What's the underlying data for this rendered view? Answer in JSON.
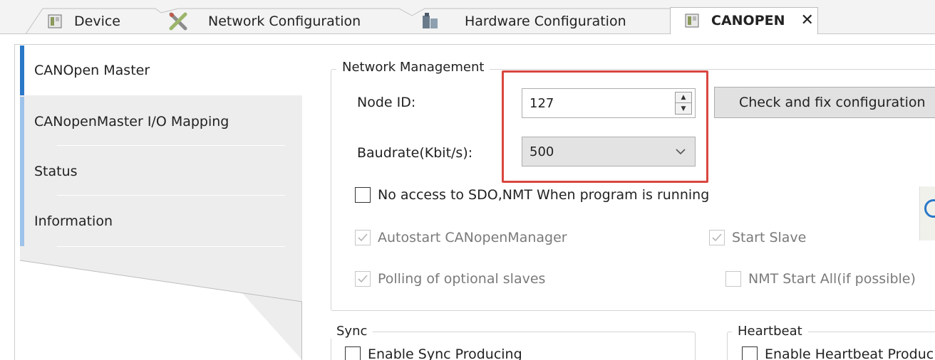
{
  "tabs": [
    {
      "label": "Device",
      "icon": "device-icon"
    },
    {
      "label": "Network Configuration",
      "icon": "tools-icon"
    },
    {
      "label": "Hardware Configuration",
      "icon": "hardware-icon"
    },
    {
      "label": "CANOPEN",
      "icon": "device-icon",
      "close": "✕"
    }
  ],
  "sidebar": {
    "items": [
      {
        "label": "CANOpen Master"
      },
      {
        "label": "CANopenMaster I/O Mapping"
      },
      {
        "label": "Status"
      },
      {
        "label": "Information"
      }
    ]
  },
  "network_management": {
    "title": "Network Management",
    "node_id_label": "Node ID:",
    "node_id_value": "127",
    "baudrate_label": "Baudrate(Kbit/s):",
    "baudrate_value": "500",
    "check_button": "Check and fix configuration",
    "no_access_label": "No access to SDO,NMT When program is running",
    "autostart_label": "Autostart CANopenManager",
    "start_slave_label": "Start Slave",
    "polling_label": "Polling of optional slaves",
    "nmt_start_all_label": "NMT Start All(if possible)"
  },
  "sync": {
    "title": "Sync",
    "enable_label": "Enable Sync Producing"
  },
  "heartbeat": {
    "title": "Heartbeat",
    "enable_label": "Enable Heartbeat Producing"
  },
  "colors": {
    "accent": "#2a78c8",
    "highlight": "#d9463f"
  }
}
